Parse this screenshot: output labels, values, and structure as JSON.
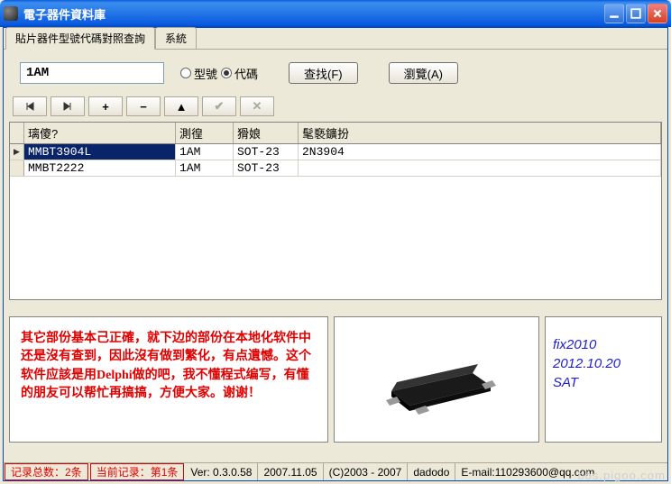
{
  "window": {
    "title": "電子器件資料庫"
  },
  "tabs": {
    "active": "貼片器件型號代碼對照查詢",
    "other": "系統"
  },
  "search": {
    "value": "1AM",
    "radio_model": "型號",
    "radio_code": "代碼",
    "find_btn": "查找(F)",
    "browse_btn": "瀏覽(A)"
  },
  "grid": {
    "headers": [
      "璃傻?",
      "測徨",
      "猾娘",
      "髦褻鑛扮"
    ],
    "rows": [
      {
        "cells": [
          "MMBT3904L",
          "1AM",
          "SOT-23",
          "2N3904"
        ],
        "selected": true
      },
      {
        "cells": [
          "MMBT2222",
          "1AM",
          "SOT-23",
          ""
        ],
        "selected": false
      }
    ]
  },
  "note": "其它部份基本己正確，就下边的部份在本地化软件中还是沒有查到，因此沒有做到繁化，有点遺憾。这个软件应該是用Delphi做的吧，我不懂程式编写，有懂的朋友可以帮忙再搞搞，方便大家。谢谢！",
  "dateinfo": {
    "l1": "fix2010",
    "l2": "2012.10.20",
    "l3": "SAT"
  },
  "status": {
    "total": "记录总数：2条",
    "current": "当前记录：第1条",
    "version": "Ver: 0.3.0.58",
    "date": "2007.11.05",
    "copyright": "(C)2003 - 2007",
    "author": "dadodo",
    "email": "E-mail:110293600@qq.com"
  },
  "watermark": "bbs.pigoo.com"
}
